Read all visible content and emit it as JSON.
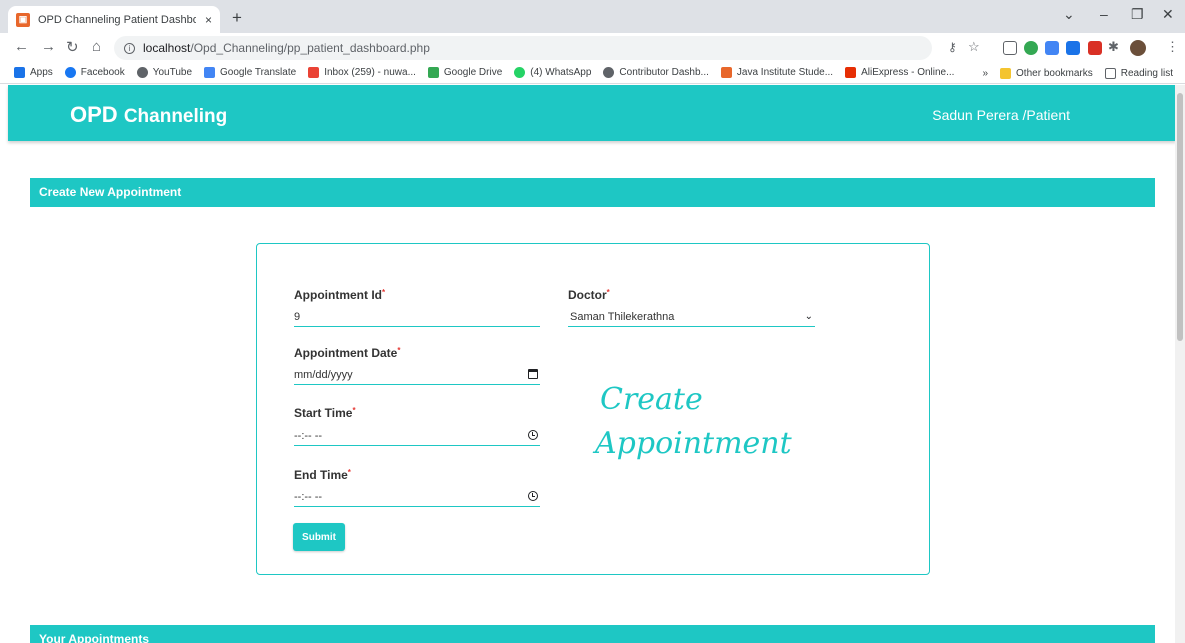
{
  "browser": {
    "tab_title": "OPD Channeling Patient Dashboard",
    "tab_close": "×",
    "new_tab": "+",
    "url_host": "localhost",
    "url_path": "/Opd_Channeling/pp_patient_dashboard.php",
    "bookmarks": [
      {
        "label": "Apps",
        "color": "#1a73e8"
      },
      {
        "label": "Facebook",
        "color": "#1877f2"
      },
      {
        "label": "YouTube",
        "color": "#5f6368"
      },
      {
        "label": "Google Translate",
        "color": "#4285f4"
      },
      {
        "label": "Inbox (259) - nuwa...",
        "color": "#ea4335"
      },
      {
        "label": "Google Drive",
        "color": "#34a853"
      },
      {
        "label": "(4) WhatsApp",
        "color": "#25d366"
      },
      {
        "label": "Contributor Dashb...",
        "color": "#5f6368"
      },
      {
        "label": "Java Institute Stude...",
        "color": "#e8672b"
      },
      {
        "label": "AliExpress - Online...",
        "color": "#e62e04"
      }
    ],
    "other_bookmarks": "Other bookmarks",
    "reading_list": "Reading list",
    "more_bookmarks": "»"
  },
  "header": {
    "brand_main": "OPD",
    "brand_sub": "Channeling",
    "user": "Sadun Perera /Patient",
    "accent_color": "#1ec7c4"
  },
  "create_section": {
    "title": "Create New Appointment",
    "fields": {
      "appointment_id": {
        "label": "Appointment Id",
        "value": "9"
      },
      "doctor": {
        "label": "Doctor",
        "value": "Saman Thilekerathna"
      },
      "appointment_date": {
        "label": "Appointment Date",
        "value": "mm/dd/yyyy"
      },
      "start_time": {
        "label": "Start Time",
        "value": "--:-- --"
      },
      "end_time": {
        "label": "End Time",
        "value": "--:-- --"
      }
    },
    "required_mark": "*",
    "submit_label": "Submit",
    "hand_line1": "Create",
    "hand_line2": "Appointment"
  },
  "appointments_section": {
    "title": "Your Appointments"
  }
}
